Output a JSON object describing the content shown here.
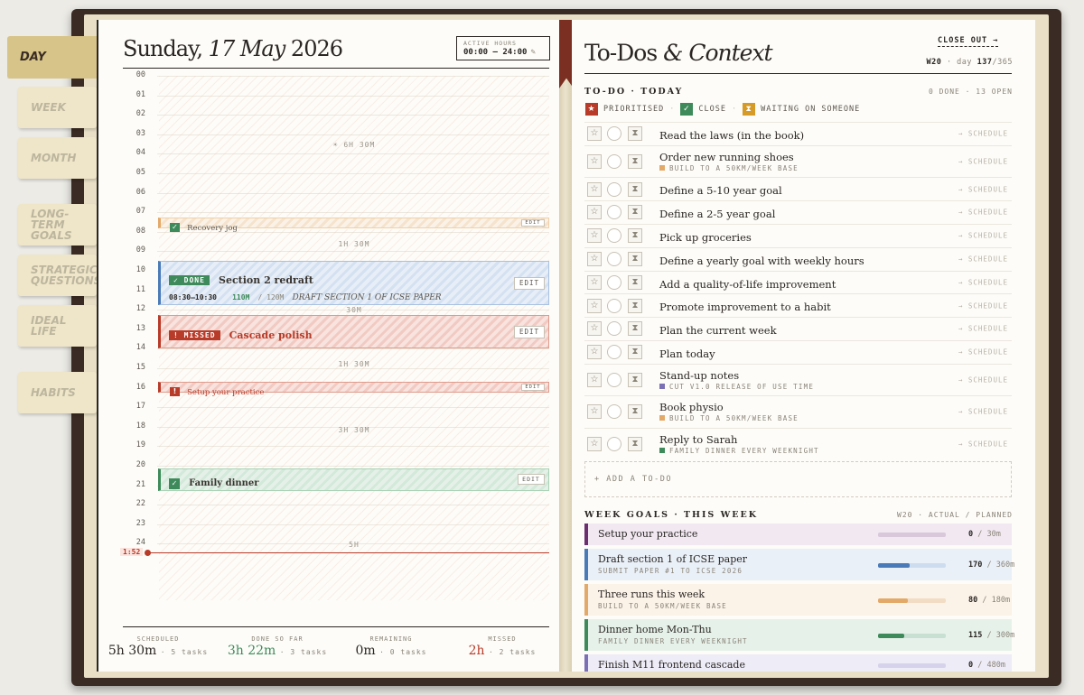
{
  "nav_tabs": [
    {
      "label": "Day",
      "active": true
    },
    {
      "label": "Week",
      "active": false
    },
    {
      "label": "Month",
      "active": false
    },
    {
      "label": "Long-Term Goals",
      "active": false
    },
    {
      "label": "Strategic Questions",
      "active": false
    },
    {
      "label": "Ideal Life",
      "active": false
    },
    {
      "label": "Habits",
      "active": false
    }
  ],
  "day": {
    "weekday": "Sunday,",
    "date_italic": "17 May",
    "year": "2026",
    "active_hours_label": "ACTIVE HOURS",
    "active_hours_value": "00:00 – 24:00",
    "active_hours_icon": "✎"
  },
  "hours": [
    "00",
    "01",
    "02",
    "03",
    "04",
    "05",
    "06",
    "07",
    "08",
    "09",
    "10",
    "11",
    "12",
    "13",
    "14",
    "15",
    "16",
    "17",
    "18",
    "19",
    "20",
    "21",
    "22",
    "23",
    "24"
  ],
  "free_gaps": [
    {
      "label": "☀ 6H 30M"
    },
    {
      "label": "1H 30M"
    },
    {
      "label": "30M"
    },
    {
      "label": "1H 30M"
    },
    {
      "label": "3H 30M"
    },
    {
      "label": "5H"
    }
  ],
  "blocks": {
    "recovery": {
      "check": "✓",
      "title": "Recovery jog",
      "edit": "EDIT"
    },
    "section2": {
      "badge": "✓ DONE",
      "title": "Section 2 redraft",
      "time": "08:30–10:30",
      "actual": "110M",
      "planned": "/ 120M",
      "note": "DRAFT SECTION 1 OF ICSE PAPER",
      "edit": "EDIT"
    },
    "cascade": {
      "badge": "! MISSED",
      "title": "Cascade polish",
      "edit": "EDIT"
    },
    "practice": {
      "mark": "!",
      "title": "Setup your practice",
      "edit": "EDIT"
    },
    "dinner": {
      "check": "✓",
      "title": "Family dinner",
      "edit": "EDIT"
    }
  },
  "now_time": "1:52",
  "stats": [
    {
      "label": "SCHEDULED",
      "value": "5h 30m",
      "sub": "· 5 tasks",
      "color": "#2a2623"
    },
    {
      "label": "DONE SO FAR",
      "value": "3h 22m",
      "sub": "· 3 tasks",
      "color": "#3e8a5a"
    },
    {
      "label": "REMAINING",
      "value": "0m",
      "sub": "· 0 tasks",
      "color": "#2a2623"
    },
    {
      "label": "MISSED",
      "value": "2h",
      "sub": "· 2 tasks",
      "color": "#b83a28"
    }
  ],
  "right": {
    "title_a": "To-Dos",
    "title_b": "& Context",
    "close_out": "CLOSE OUT →",
    "week_tag": "W20",
    "day_label": "· day",
    "day_num": "137",
    "day_total": "/365",
    "todo_header": "TO-DO · TODAY",
    "todo_counts": "0 DONE · 13 OPEN",
    "legend": [
      {
        "icon": "★",
        "label": "PRIORITISED",
        "color": "#b83a28"
      },
      {
        "icon": "✓",
        "label": "CLOSE",
        "color": "#3e8a5a"
      },
      {
        "icon": "⧗",
        "label": "WAITING ON SOMEONE",
        "color": "#d69a26"
      }
    ],
    "icon_star": "☆",
    "icon_wait": "⧗",
    "schedule_label": "→ SCHEDULE",
    "todos": [
      {
        "title": "Read the laws (in the book)",
        "sub": "",
        "color": ""
      },
      {
        "title": "Order new running shoes",
        "sub": "BUILD TO A 50KM/WEEK BASE",
        "color": "#e3a968"
      },
      {
        "title": "Define a 5-10 year goal",
        "sub": "",
        "color": ""
      },
      {
        "title": "Define a 2-5 year goal",
        "sub": "",
        "color": ""
      },
      {
        "title": "Pick up groceries",
        "sub": "",
        "color": ""
      },
      {
        "title": "Define a yearly goal with weekly hours",
        "sub": "",
        "color": ""
      },
      {
        "title": "Add a quality-of-life improvement",
        "sub": "",
        "color": ""
      },
      {
        "title": "Promote improvement to a habit",
        "sub": "",
        "color": ""
      },
      {
        "title": "Plan the current week",
        "sub": "",
        "color": ""
      },
      {
        "title": "Plan today",
        "sub": "",
        "color": ""
      },
      {
        "title": "Stand-up notes",
        "sub": "CUT V1.0 RELEASE OF USE TIME",
        "color": "#7b6fb5"
      },
      {
        "title": "Book physio",
        "sub": "BUILD TO A 50KM/WEEK BASE",
        "color": "#e3a968"
      },
      {
        "title": "Reply to Sarah",
        "sub": "FAMILY DINNER EVERY WEEKNIGHT",
        "color": "#3e8a5a"
      }
    ],
    "add_todo": "+ ADD A TO-DO",
    "goals_header": "WEEK GOALS · THIS WEEK",
    "goals_right": "W20 · ACTUAL / PLANNED",
    "goals": [
      {
        "title": "Setup your practice",
        "sub": "",
        "actual": "0",
        "planned": "/ 30m",
        "progress": 0,
        "color": "#6b2e6e",
        "bg": "#f1e8f1",
        "track": "#d9c8da"
      },
      {
        "title": "Draft section 1 of ICSE paper",
        "sub": "SUBMIT PAPER #1 TO ICSE 2026",
        "actual": "170",
        "planned": "/ 360m",
        "progress": 0.47,
        "color": "#4a7ab8",
        "bg": "#eaf0f8",
        "track": "#cddcee"
      },
      {
        "title": "Three runs this week",
        "sub": "BUILD TO A 50KM/WEEK BASE",
        "actual": "80",
        "planned": "/ 180m",
        "progress": 0.44,
        "color": "#e3a968",
        "bg": "#fbf2e8",
        "track": "#f3dcc4"
      },
      {
        "title": "Dinner home Mon-Thu",
        "sub": "FAMILY DINNER EVERY WEEKNIGHT",
        "actual": "115",
        "planned": "/ 300m",
        "progress": 0.38,
        "color": "#3e8a5a",
        "bg": "#e6f1ea",
        "track": "#c8e0d1"
      },
      {
        "title": "Finish M11 frontend cascade",
        "sub": "",
        "actual": "0",
        "planned": "/ 480m",
        "progress": 0,
        "color": "#7b6fb5",
        "bg": "#eeecf7",
        "track": "#d6d2eb"
      }
    ]
  }
}
